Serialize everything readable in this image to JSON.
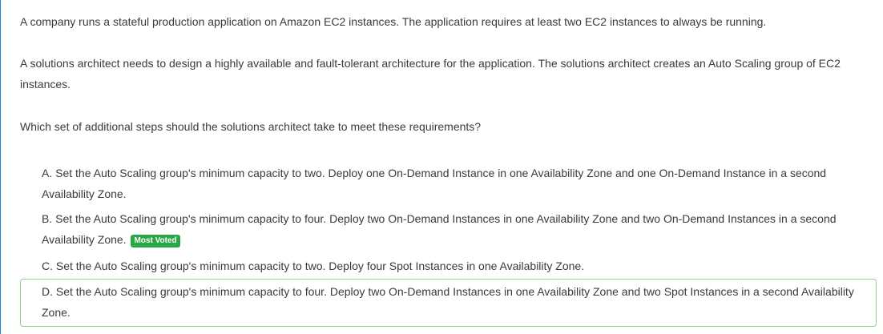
{
  "question": {
    "paragraph_1": "A company runs a stateful production application on Amazon EC2 instances. The application requires at least two EC2 instances to always be running.",
    "paragraph_2": "A solutions architect needs to design a highly available and fault-tolerant architecture for the application. The solutions architect creates an Auto Scaling group of EC2 instances.",
    "paragraph_3": "Which set of additional steps should the solutions architect take to meet these requirements?"
  },
  "choices": [
    {
      "letter": "A.",
      "text": "Set the Auto Scaling group's minimum capacity to two. Deploy one On-Demand Instance in one Availability Zone and one On-Demand Instance in a second Availability Zone."
    },
    {
      "letter": "B.",
      "text": "Set the Auto Scaling group's minimum capacity to four. Deploy two On-Demand Instances in one Availability Zone and two On-Demand Instances in a second Availability Zone.",
      "badge": "Most Voted"
    },
    {
      "letter": "C.",
      "text": "Set the Auto Scaling group's minimum capacity to two. Deploy four Spot Instances in one Availability Zone."
    },
    {
      "letter": "D.",
      "text": "Set the Auto Scaling group's minimum capacity to four. Deploy two On-Demand Instances in one Availability Zone and two Spot Instances in a second Availability Zone."
    }
  ],
  "colors": {
    "accent_border": "#1f8ad6",
    "selected_border": "#8fd18f",
    "badge_bg": "#28a745"
  }
}
